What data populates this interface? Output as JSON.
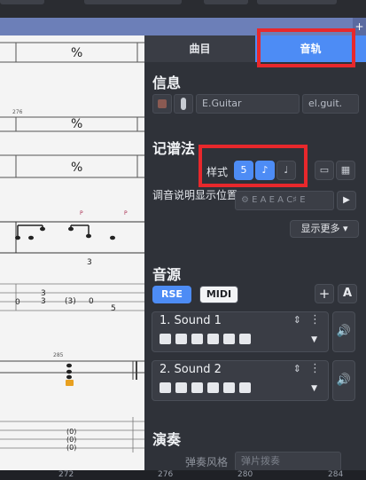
{
  "tabs": {
    "song_label": "曲目",
    "track_label": "音轨"
  },
  "info": {
    "title": "信息",
    "instrument_name": "E.Guitar",
    "short_name": "el.guit."
  },
  "notation": {
    "title": "记谱法",
    "style_label": "样式",
    "tuning_label": "调音说明显示位置",
    "tuning_value": "E A E A C♯ E",
    "show_more": "显示更多"
  },
  "sound": {
    "title": "音源",
    "rse_label": "RSE",
    "midi_label": "MIDI",
    "items": [
      {
        "name": "1. Sound 1"
      },
      {
        "name": "2. Sound 2"
      }
    ]
  },
  "performance": {
    "title": "演奏",
    "style_label": "弹奏风格",
    "style_value": "弹片拨奏"
  },
  "score": {
    "bar_numbers": [
      "276",
      "285"
    ],
    "tab_numbers": [
      "0",
      "3",
      "3",
      "(3)",
      "0",
      "5",
      "0"
    ],
    "tuplet": "3"
  },
  "ruler": [
    "272",
    "276",
    "280",
    "284"
  ],
  "colors": {
    "accent": "#4d8cf5",
    "highlight": "#e8282c",
    "panel": "#2f3239"
  }
}
